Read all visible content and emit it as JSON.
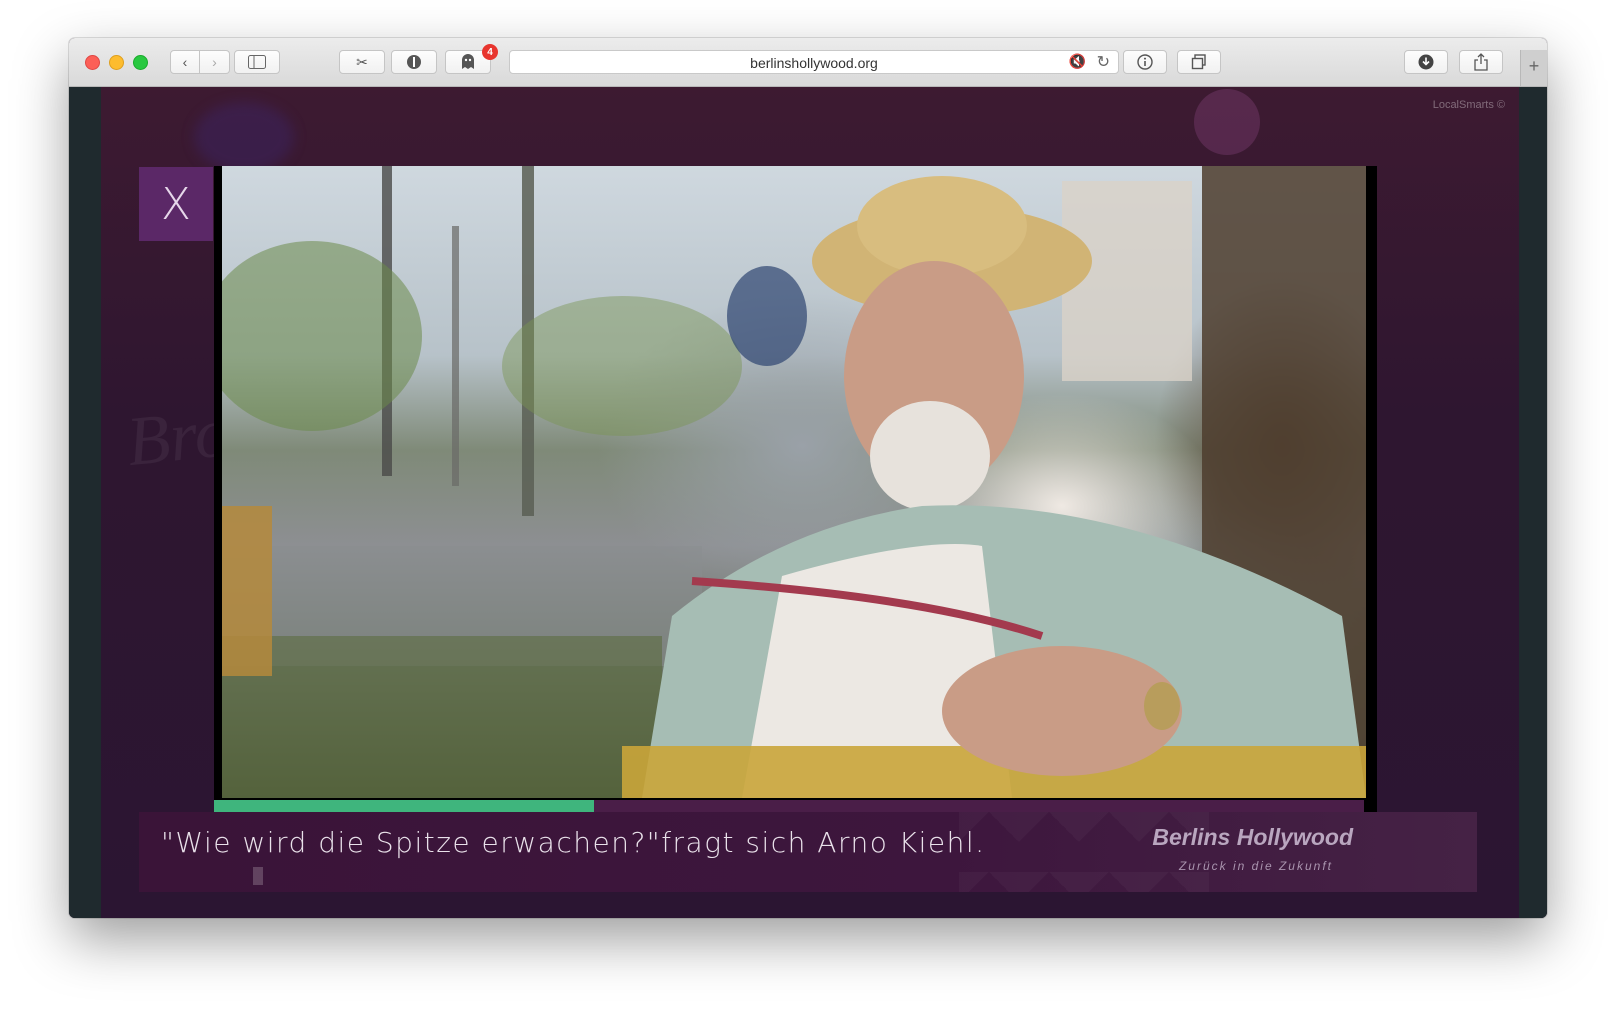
{
  "browser": {
    "url": "berlinshollywood.org",
    "notification_badge": "4"
  },
  "page": {
    "corner_credit": "LocalSmarts ©",
    "watermark": "Brot",
    "close_label": "X",
    "caption": "\"Wie wird die Spitze erwachen?\"fragt sich Arno Kiehl.",
    "brand_title": "Berlins Hollywood",
    "brand_subtitle": "Zurück in die Zukunft"
  },
  "video": {
    "progress_fraction": 0.33
  },
  "colors": {
    "progress": "#3fb57d",
    "close_button": "#5b2867",
    "caption_bar": "#3a1438"
  }
}
